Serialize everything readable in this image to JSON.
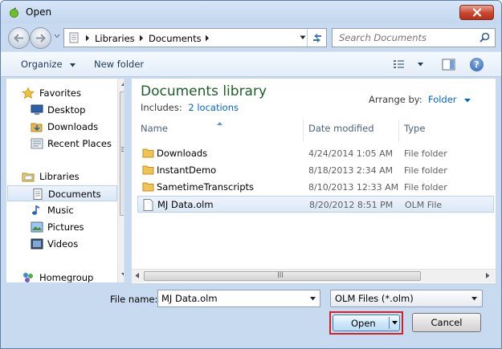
{
  "window": {
    "title": "Open"
  },
  "address": {
    "crumbs": [
      "Libraries",
      "Documents"
    ]
  },
  "search": {
    "placeholder": "Search Documents"
  },
  "toolbar": {
    "organize_label": "Organize",
    "new_folder_label": "New folder"
  },
  "navigation": {
    "items": [
      {
        "label": "Favorites",
        "icon": "star-icon"
      },
      {
        "label": "Desktop",
        "icon": "desktop-icon"
      },
      {
        "label": "Downloads",
        "icon": "downloads-icon"
      },
      {
        "label": "Recent Places",
        "icon": "recent-places-icon"
      },
      {
        "label": "Libraries",
        "icon": "libraries-icon"
      },
      {
        "label": "Documents",
        "icon": "documents-icon"
      },
      {
        "label": "Music",
        "icon": "music-icon"
      },
      {
        "label": "Pictures",
        "icon": "pictures-icon"
      },
      {
        "label": "Videos",
        "icon": "videos-icon"
      },
      {
        "label": "Homegroup",
        "icon": "homegroup-icon"
      }
    ],
    "selected": "Documents"
  },
  "library": {
    "title": "Documents library",
    "includes_label": "Includes:",
    "locations_link": "2 locations",
    "arrange_label": "Arrange by:",
    "arrange_value": "Folder"
  },
  "columns": {
    "name": "Name",
    "date": "Date modified",
    "type": "Type"
  },
  "files": [
    {
      "name": "Downloads",
      "date": "4/24/2014 1:05 AM",
      "type": "File folder",
      "icon": "folder-icon"
    },
    {
      "name": "InstantDemo",
      "date": "8/18/2013 2:34 AM",
      "type": "File folder",
      "icon": "folder-icon"
    },
    {
      "name": "SametimeTranscripts",
      "date": "8/10/2013 12:33 AM",
      "type": "File folder",
      "icon": "folder-icon"
    },
    {
      "name": "MJ Data.olm",
      "date": "8/20/2012 8:51 PM",
      "type": "OLM File",
      "icon": "file-icon",
      "selected": true
    }
  ],
  "footer": {
    "file_name_label": "File name:",
    "file_name_value": "MJ Data.olm",
    "file_type_value": "OLM Files (*.olm)",
    "open_label": "Open",
    "cancel_label": "Cancel"
  }
}
